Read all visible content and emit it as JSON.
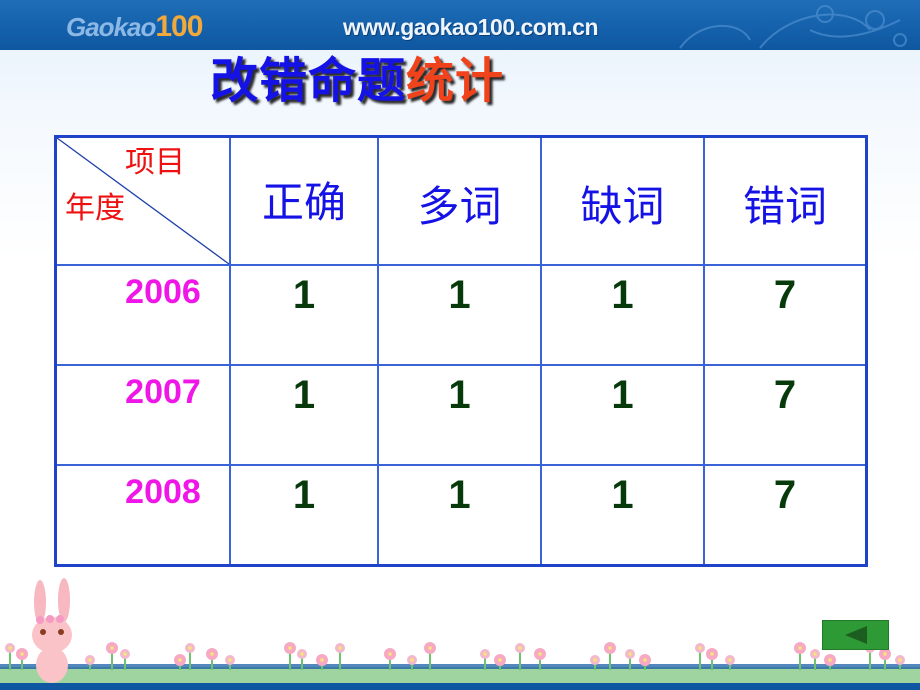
{
  "header": {
    "logo_text": "Gaokao",
    "logo_number": "100",
    "site_url": "www.gaokao100.com.cn"
  },
  "title": {
    "part_blue": "改错命题",
    "part_red": "统计"
  },
  "table": {
    "corner_top_label": "项目",
    "corner_bottom_label": "年度",
    "columns": [
      "正确",
      "多词",
      "缺词",
      "错词"
    ],
    "rows": [
      {
        "year": "2006",
        "values": [
          "1",
          "1",
          "1",
          "7"
        ]
      },
      {
        "year": "2007",
        "values": [
          "1",
          "1",
          "1",
          "7"
        ]
      },
      {
        "year": "2008",
        "values": [
          "1",
          "1",
          "1",
          "7"
        ]
      }
    ]
  },
  "navigation": {
    "back_icon": "left-triangle-icon"
  },
  "colors": {
    "header_blue": "#1460aa",
    "title_blue": "#1512e6",
    "title_red": "#f0431c",
    "corner_red": "#ee1111",
    "year_magenta": "#f016e8",
    "value_green": "#073a0b",
    "table_border": "#1f43c8",
    "nav_green": "#2e9a36"
  }
}
